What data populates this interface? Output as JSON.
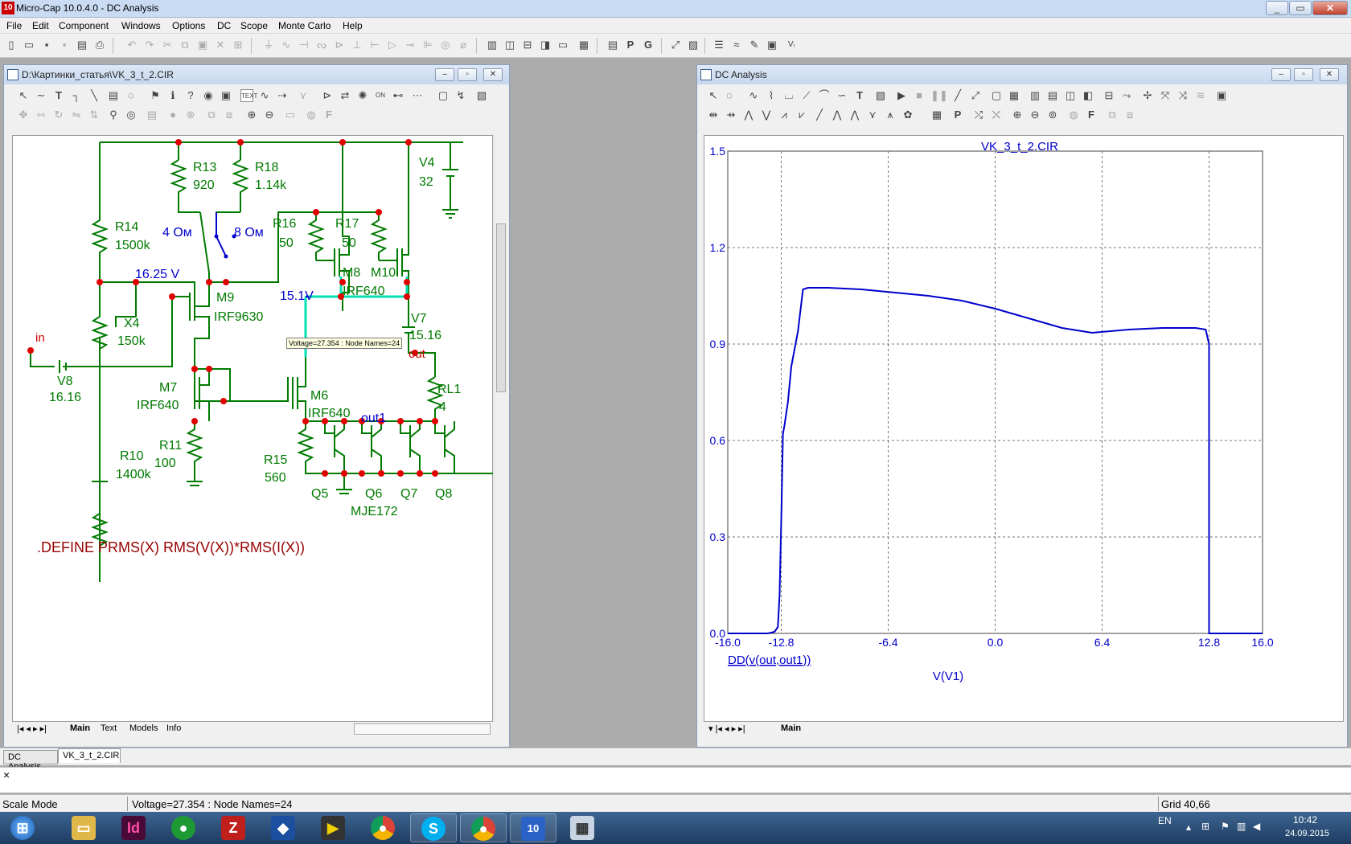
{
  "app": {
    "title": "Micro-Cap 10.0.4.0 - DC Analysis",
    "icon_text": "10"
  },
  "menu": [
    "File",
    "Edit",
    "Component",
    "Windows",
    "Options",
    "DC",
    "Scope",
    "Monte Carlo",
    "Help"
  ],
  "schematic_window": {
    "title": "D:\\Картинки_статья\\VK_3_t_2.CIR",
    "tabs": [
      "Main",
      "Text",
      "Models",
      "Info"
    ],
    "tooltip": "Voltage=27.354 : Node Names=24",
    "define_text": ".DEFINE PRMS(X) RMS(V(X))*RMS(I(X))",
    "labels": {
      "r13": "R13",
      "r13v": "920",
      "r18": "R18",
      "r18v": "1.14k",
      "v4": "V4",
      "v4v": "32",
      "r14": "R14",
      "r14v": "1500k",
      "ohm4": "4 Ом",
      "ohm8": "8 Ом",
      "r16": "R16",
      "r16v": "50",
      "r17": "R17",
      "r17v": "50",
      "m8": "M8",
      "m10": "M10",
      "m8v": "IRF640",
      "v1625": "16.25 V",
      "v151": "15.1V",
      "m9": "M9",
      "m9v": "IRF9630",
      "x4": "X4",
      "x4v": "150k",
      "in": "in",
      "v7": "V7",
      "v7v": "15.16",
      "out": "out",
      "v8": "V8",
      "v8v": "16.16",
      "m7": "M7",
      "m7v": "IRF640",
      "m6": "M6",
      "m6v": "IRF640",
      "rl1": "RL1",
      "rl1v": "4",
      "out1": "out1",
      "r11": "R11",
      "r11v": "100",
      "r10": "R10",
      "r10v": "1400k",
      "r15": "R15",
      "r15v": "560",
      "q5": "Q5",
      "q6": "Q6",
      "q7": "Q7",
      "q8": "Q8",
      "mje": "MJE172"
    }
  },
  "plot_window": {
    "title": "DC Analysis",
    "tabs": [
      "Main"
    ]
  },
  "chart_data": {
    "type": "line",
    "title": "VK_3_t_2.CIR",
    "xlabel": "V(V1)",
    "ylabel": "",
    "trace_label": "DD(v(out,out1))",
    "xlim": [
      -16.0,
      16.0
    ],
    "ylim": [
      0.0,
      1.5
    ],
    "xticks": [
      "-16.0",
      "-12.8",
      "-6.4",
      "0.0",
      "6.4",
      "12.8",
      "16.0"
    ],
    "yticks": [
      "0.0",
      "0.3",
      "0.6",
      "0.9",
      "1.2",
      "1.5"
    ],
    "grid": true,
    "color": "#0000cc",
    "series": [
      {
        "x": [
          -16.0,
          -13.6,
          -13.2,
          -13.0,
          -12.9,
          -12.8,
          -12.7,
          -12.6,
          -12.4,
          -12.2,
          -11.8,
          -11.5,
          -11.2,
          -10.0,
          -8.0,
          -6.0,
          -4.0,
          -2.0,
          0.0,
          2.0,
          4.0,
          5.8,
          8.0,
          10.0,
          12.0,
          12.6,
          12.8,
          12.8,
          14.0,
          16.0
        ],
        "values": [
          0.0,
          0.0,
          0.005,
          0.02,
          0.12,
          0.35,
          0.62,
          0.65,
          0.72,
          0.83,
          0.94,
          1.07,
          1.075,
          1.075,
          1.07,
          1.06,
          1.05,
          1.035,
          1.01,
          0.98,
          0.95,
          0.935,
          0.945,
          0.95,
          0.95,
          0.945,
          0.9,
          0.0,
          0.0,
          0.0
        ]
      }
    ]
  },
  "doc_tabs": [
    "DC Analysis",
    "VK_3_t_2.CIR"
  ],
  "command_text": "×",
  "status": {
    "mode": "Scale Mode",
    "info": "Voltage=27.354 : Node Names=24",
    "grid": "Grid 40,66"
  },
  "taskbar": {
    "lang": "EN",
    "time": "10:42",
    "date": "24.09.2015"
  }
}
